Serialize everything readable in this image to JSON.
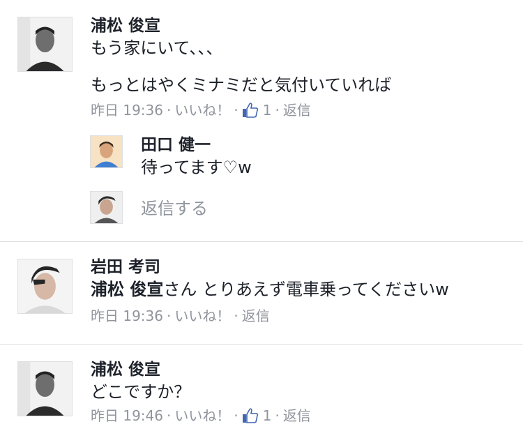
{
  "comments": [
    {
      "author": "浦松 俊宣",
      "line1": "もう家にいて、、、",
      "line2": "もっとはやくミナミだと気付いていれば",
      "time": "昨日 19:36",
      "like_label": "いいね！",
      "like_count": "1",
      "reply_label": "返信",
      "replies": [
        {
          "author": "田口 健一",
          "text": "待ってます♡w"
        }
      ],
      "reply_placeholder": "返信する"
    },
    {
      "author": "岩田 考司",
      "mention": "浦松 俊宣",
      "text": "さん とりあえず電車乗ってくださいw",
      "time": "昨日 19:36",
      "like_label": "いいね！",
      "reply_label": "返信"
    },
    {
      "author": "浦松 俊宣",
      "text": "どこですか？",
      "time": "昨日 19:46",
      "like_label": "いいね！",
      "like_count": "1",
      "reply_label": "返信"
    }
  ],
  "colors": {
    "meta_gray": "#90949c",
    "like_blue": "#4267b2",
    "divider": "#dddfe2"
  },
  "icons": [
    "thumbs-up-icon"
  ]
}
